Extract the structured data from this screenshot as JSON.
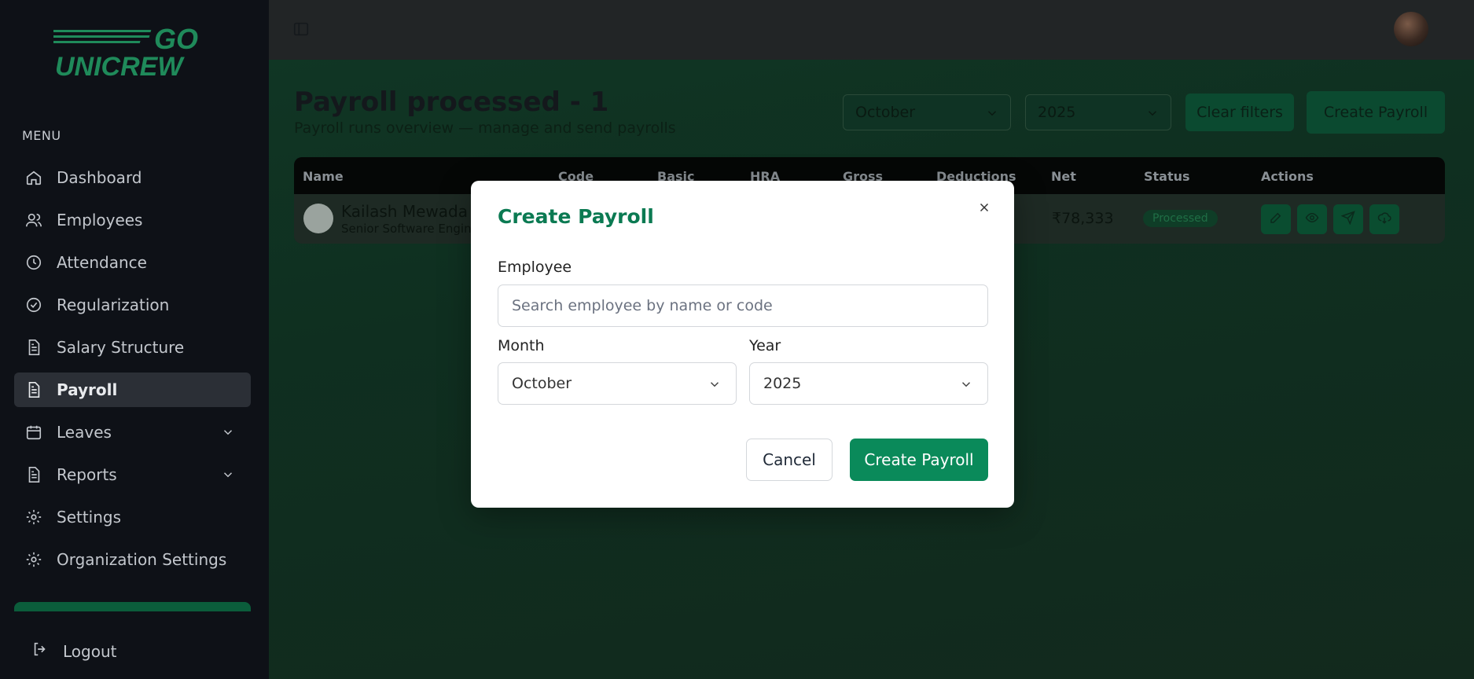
{
  "logo": {
    "text_top": "GO",
    "text_bottom": "UNICREW"
  },
  "sidebar": {
    "menu_label": "MENU",
    "items": [
      {
        "label": "Dashboard",
        "icon": "home-icon"
      },
      {
        "label": "Employees",
        "icon": "users-icon"
      },
      {
        "label": "Attendance",
        "icon": "clock-icon"
      },
      {
        "label": "Regularization",
        "icon": "check-circle-icon"
      },
      {
        "label": "Salary Structure",
        "icon": "document-icon"
      },
      {
        "label": "Payroll",
        "icon": "document-icon",
        "active": true
      },
      {
        "label": "Leaves",
        "icon": "calendar-icon",
        "expandable": true
      },
      {
        "label": "Reports",
        "icon": "document-icon",
        "expandable": true
      },
      {
        "label": "Settings",
        "icon": "gear-icon"
      },
      {
        "label": "Organization Settings",
        "icon": "gear-icon"
      }
    ],
    "logout_label": "Logout"
  },
  "page": {
    "title": "Payroll processed - 1",
    "subtitle": "Payroll runs overview — manage and send payrolls",
    "filter_month": "October",
    "filter_year": "2025",
    "clear_filters_label": "Clear filters",
    "create_payroll_label": "Create Payroll"
  },
  "table": {
    "headers": [
      "Name",
      "Code",
      "Basic",
      "HRA",
      "Gross",
      "Deductions",
      "Net",
      "Status",
      "Actions"
    ],
    "rows": [
      {
        "name": "Kailash Mewada",
        "role": "Senior Software Engin",
        "net": "₹78,333",
        "status": "Processed"
      }
    ]
  },
  "modal": {
    "title": "Create Payroll",
    "employee_label": "Employee",
    "employee_placeholder": "Search employee by name or code",
    "month_label": "Month",
    "month_value": "October",
    "year_label": "Year",
    "year_value": "2025",
    "cancel_label": "Cancel",
    "create_label": "Create Payroll"
  },
  "colors": {
    "brand_green": "#0a8a5a",
    "title_green": "#0b7a52",
    "sidebar_bg": "#0e1117"
  }
}
